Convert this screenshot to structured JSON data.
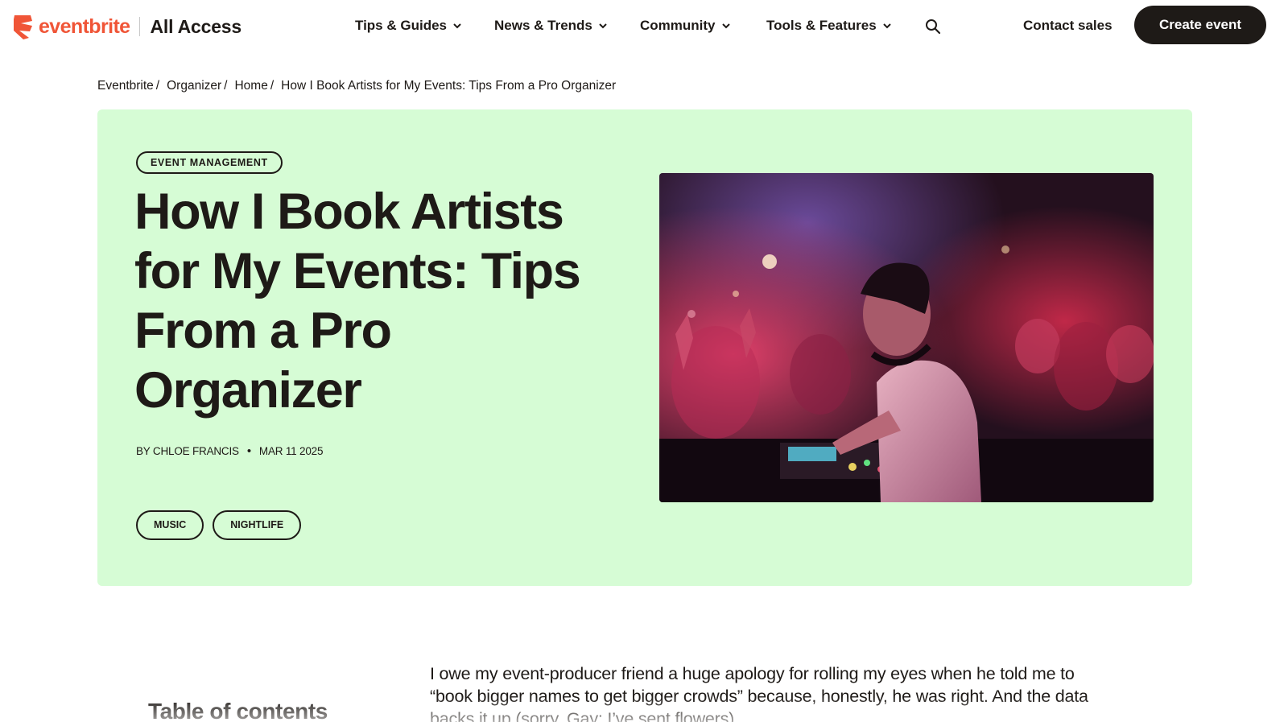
{
  "brand": {
    "name": "eventbrite",
    "section": "All Access",
    "accent_color": "#f05537"
  },
  "nav": {
    "items": [
      {
        "label": "Tips & Guides",
        "icon": "chevron-down-icon"
      },
      {
        "label": "News & Trends",
        "icon": "chevron-down-icon"
      },
      {
        "label": "Community",
        "icon": "chevron-down-icon"
      },
      {
        "label": "Tools & Features",
        "icon": "chevron-down-icon"
      }
    ],
    "search_icon": "search-icon",
    "contact_label": "Contact sales",
    "cta_label": "Create event"
  },
  "breadcrumb": {
    "items": [
      "Eventbrite",
      "Organizer",
      "Home"
    ],
    "separator": "/",
    "current": "How I Book Artists for My Events: Tips From a Pro Organizer"
  },
  "hero": {
    "background": "#d6fcd5",
    "category": "EVENT MANAGEMENT",
    "title": "How I Book Artists for My Events: Tips From a Pro Organizer",
    "author": "BY CHLOE FRANCIS",
    "bullet": "•",
    "date": "MAR 11 2025",
    "tags": [
      "MUSIC",
      "NIGHTLIFE"
    ],
    "image": "dj-performing-at-nightclub-photo"
  },
  "toc": {
    "title": "Table of contents"
  },
  "article": {
    "intro": "I owe my event-producer friend a huge apology for rolling my eyes when he told me to “book bigger names to get bigger crowds” because, honestly, he was right. And the data backs it up (sorry, Gay; I’ve sent flowers)."
  }
}
